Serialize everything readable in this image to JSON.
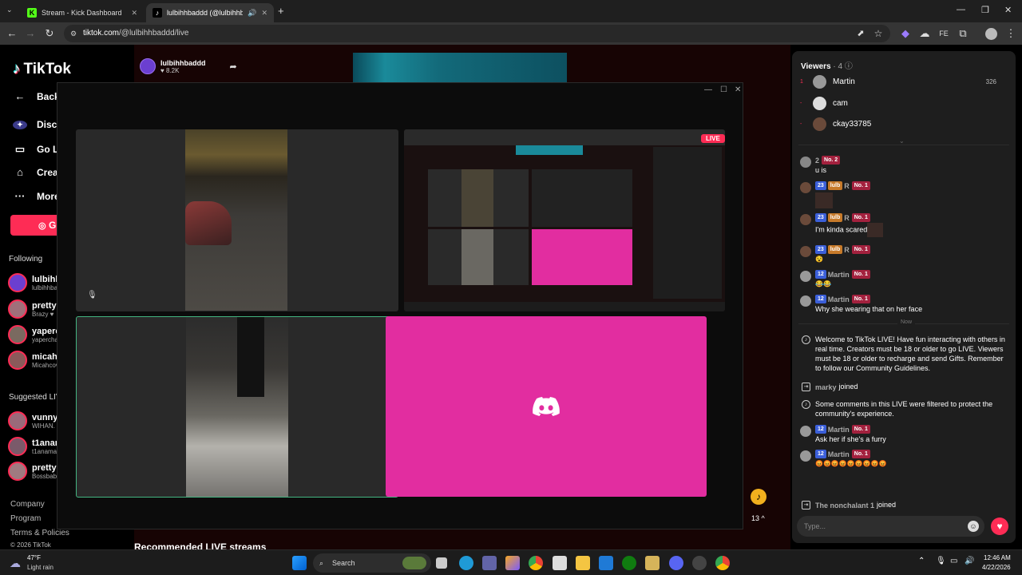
{
  "browser": {
    "tabs": [
      {
        "title": "Stream - Kick Dashboard",
        "active": false
      },
      {
        "title": "lulbihhbaddd (@lulbihhbaddd)",
        "active": true
      }
    ],
    "url_host": "tiktok.com",
    "url_path": "/@lulbihhbaddd/live"
  },
  "sidebar": {
    "logo": "TikTok",
    "nav": [
      {
        "label": "Back",
        "icon": "back-arrow-icon"
      },
      {
        "label": "Disco",
        "icon": "discover-icon"
      },
      {
        "label": "Go LIV",
        "icon": "camera-icon"
      },
      {
        "label": "Create",
        "icon": "create-icon"
      },
      {
        "label": "More",
        "icon": "more-icon"
      }
    ],
    "go_live_button": "G",
    "following_title": "Following",
    "following": [
      {
        "name": "lulbihh",
        "sub": "lulbihhba"
      },
      {
        "name": "prettyl",
        "sub": "Brazy ♥"
      },
      {
        "name": "yaperc",
        "sub": "yapercha"
      },
      {
        "name": "micahc",
        "sub": "Micahcov"
      }
    ],
    "suggested_title": "Suggested LIV",
    "suggested": [
      {
        "name": "vunnyp",
        "sub": "WIHAN."
      },
      {
        "name": "t1anan",
        "sub": "t1anama"
      },
      {
        "name": "prettyc",
        "sub": "Bossbab"
      }
    ],
    "footer": [
      "Company",
      "Program",
      "Terms & Policies",
      "© 2026 TikTok"
    ]
  },
  "stream": {
    "host_name": "lulbihhbaddd",
    "host_likes": "♥ 8.2K",
    "recommended_title": "Recommended LIVE streams",
    "coin_count": "13 ^",
    "live_badge": "LIVE"
  },
  "chat": {
    "viewers_title": "Viewers",
    "viewers_count": "· 4",
    "viewers": [
      {
        "rank": "1",
        "name": "Martin",
        "score": "326"
      },
      {
        "rank": "-",
        "name": "cam",
        "score": ""
      },
      {
        "rank": "-",
        "name": "ckay33785",
        "score": ""
      }
    ],
    "messages": [
      {
        "kind": "user",
        "level": "2",
        "rank_badge": "No. 2",
        "team": "",
        "extra": "",
        "name": "",
        "text": "u is"
      },
      {
        "kind": "user",
        "level": "23",
        "rank_badge": "No. 1",
        "team": "lulb",
        "extra": "R",
        "name": "",
        "text": ""
      },
      {
        "kind": "user",
        "level": "23",
        "rank_badge": "No. 1",
        "team": "lulb",
        "extra": "R",
        "name": "",
        "text": "I'm kinda scared"
      },
      {
        "kind": "user",
        "level": "23",
        "rank_badge": "No. 1",
        "team": "lulb",
        "extra": "R",
        "name": "",
        "text": "😵"
      },
      {
        "kind": "user",
        "level": "12",
        "rank_badge": "No. 1",
        "team": "",
        "extra": "",
        "name": "Martin",
        "text": "😂😂"
      },
      {
        "kind": "user",
        "level": "12",
        "rank_badge": "No. 1",
        "team": "",
        "extra": "",
        "name": "Martin",
        "text": "Why she wearing that on her face"
      }
    ],
    "divider": "Now",
    "system_messages": [
      {
        "text": "Welcome to TikTok LIVE! Have fun interacting with others in real time. Creators must be 18 or older to go LIVE. Viewers must be 18 or older to recharge and send Gifts. Remember to follow our Community Guidelines."
      },
      {
        "name": "marky",
        "text": "joined"
      },
      {
        "text": "Some comments in this LIVE were filtered to protect the community's experience."
      }
    ],
    "late_messages": [
      {
        "level": "12",
        "rank_badge": "No. 1",
        "name": "Martin",
        "text": "Ask her if she's a furry"
      },
      {
        "level": "12",
        "rank_badge": "No. 1",
        "name": "Martin",
        "text": "😡😡😡😡😡😡😡😡😡"
      }
    ],
    "joined": {
      "name": "The nonchalant 1",
      "text": "joined"
    },
    "input_placeholder": "Type..."
  },
  "taskbar": {
    "weather_temp": "47°F",
    "weather_desc": "Light rain",
    "search": "Search",
    "time": "12:46 AM",
    "date": "4/22/2026"
  },
  "colors": {
    "accent": "#fe2c55",
    "discord_pink": "#e22da0",
    "level_blue": "#3b5fd9"
  }
}
